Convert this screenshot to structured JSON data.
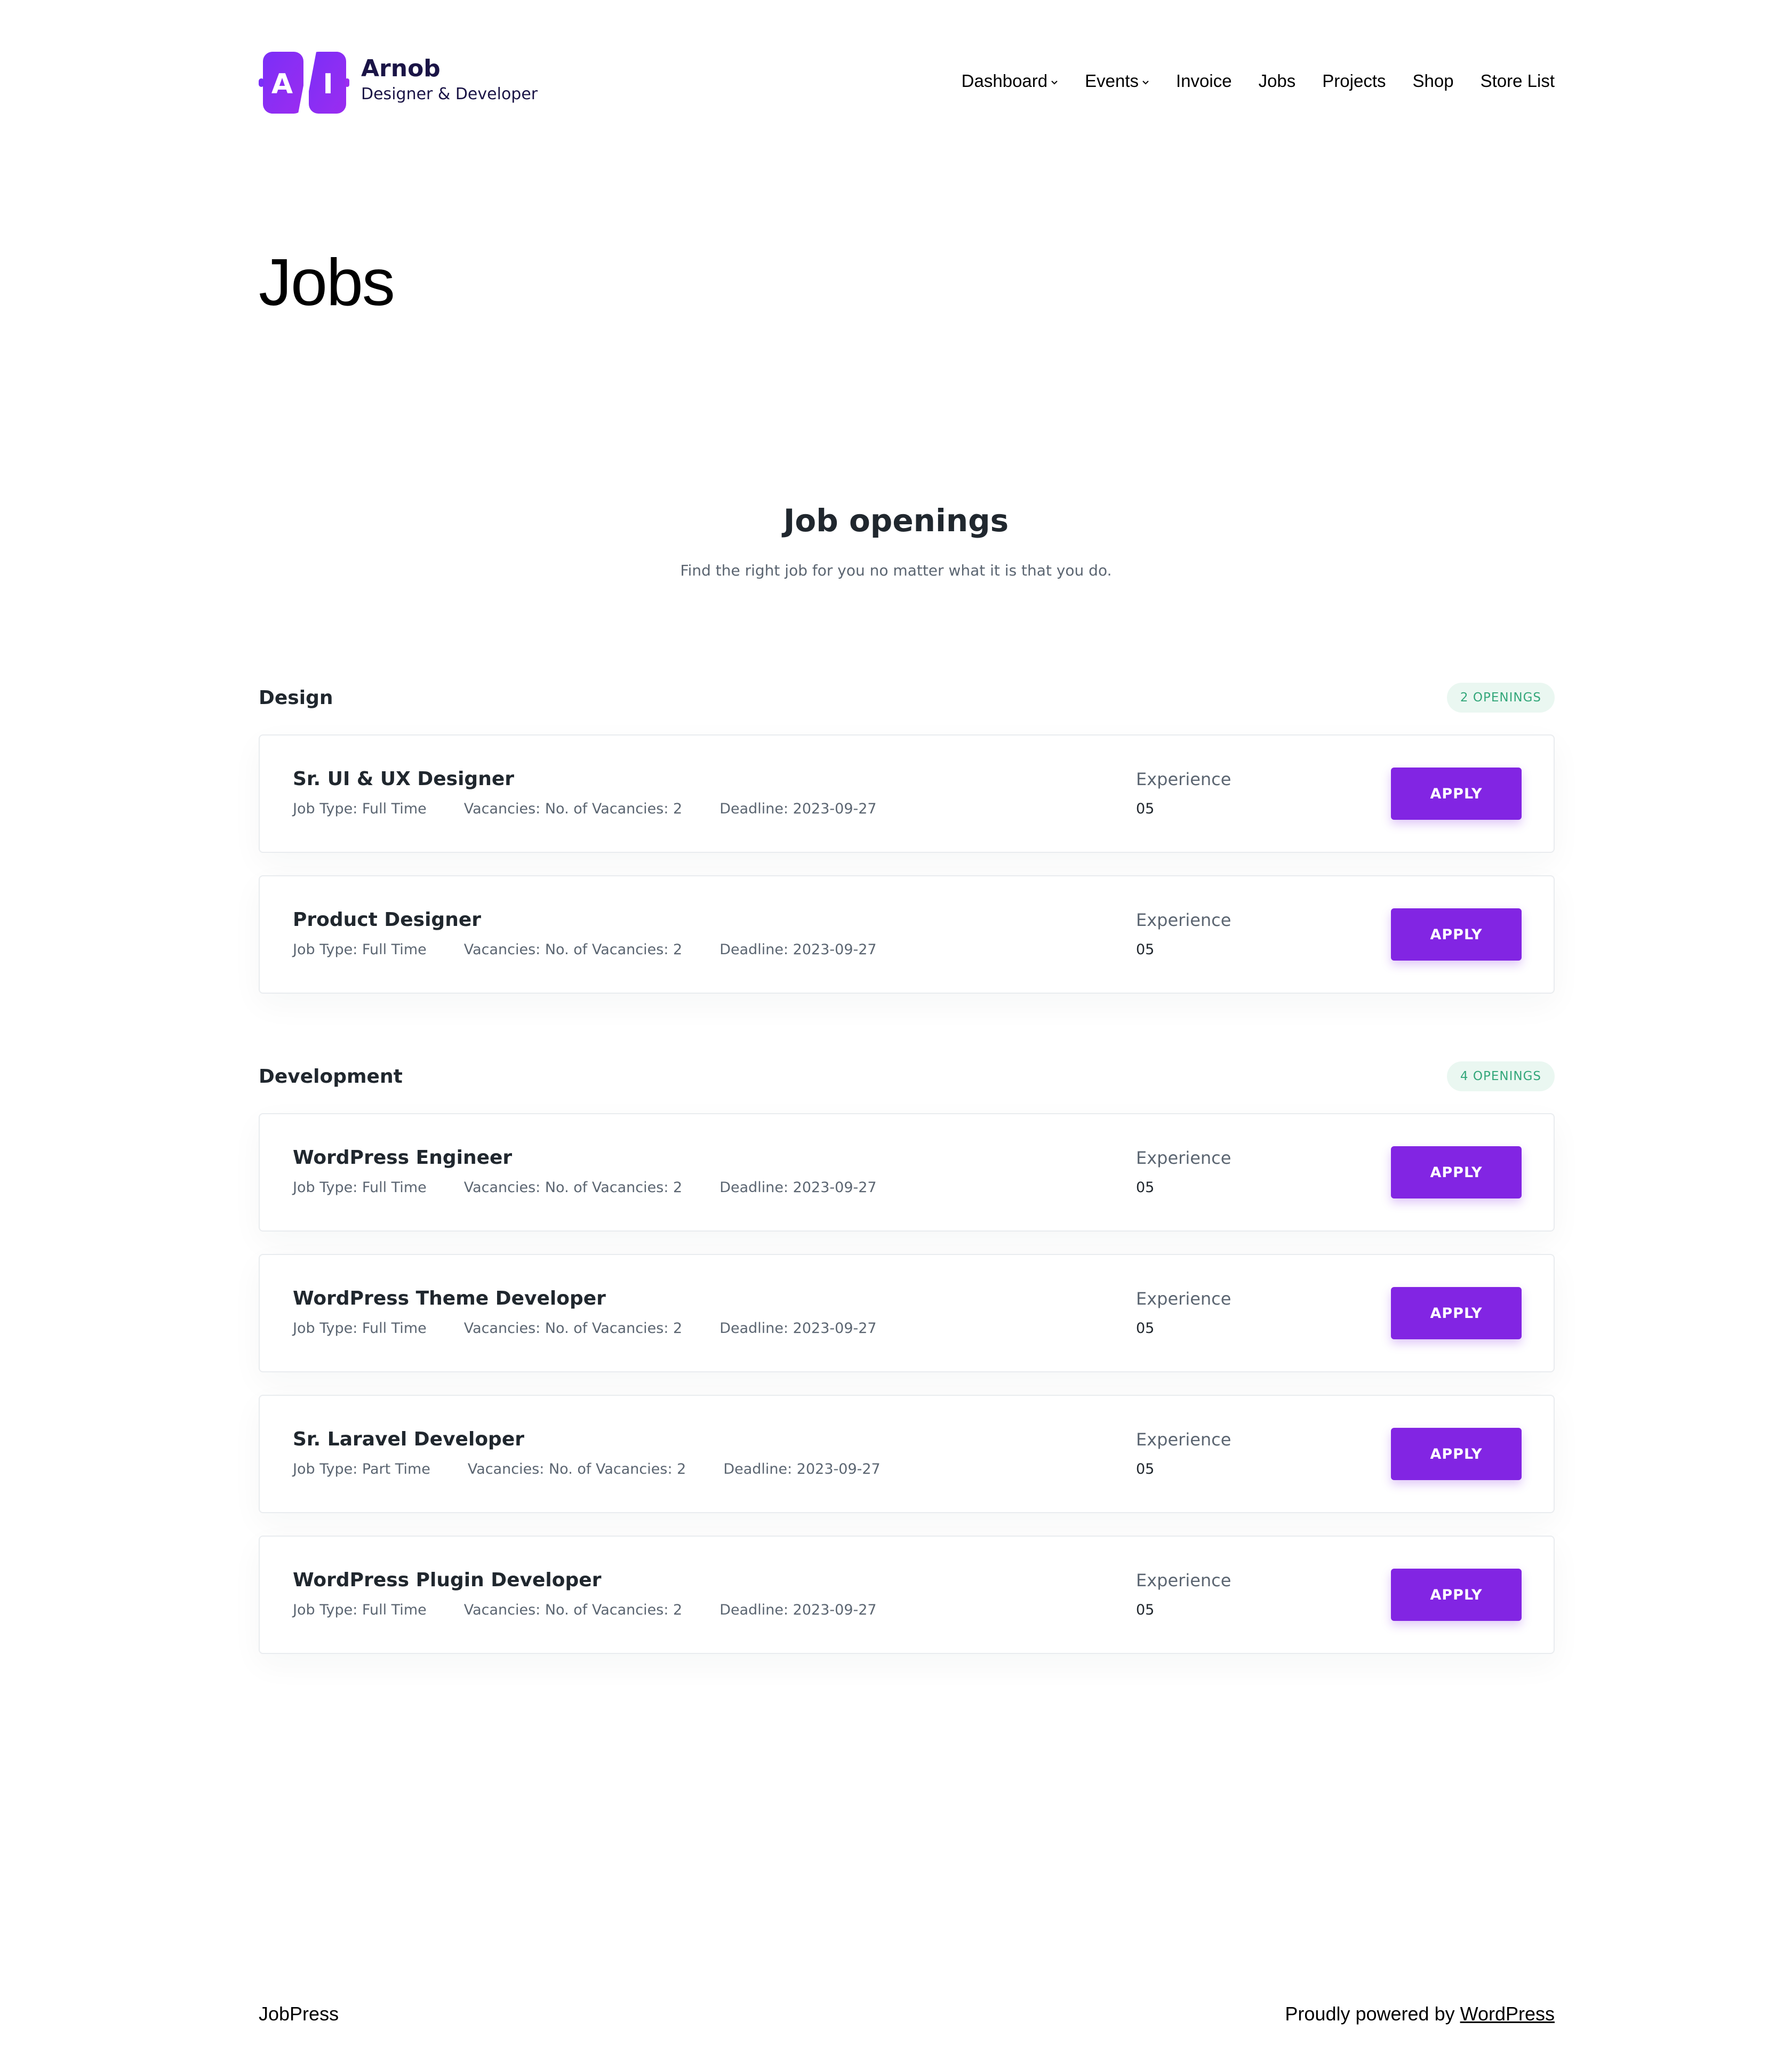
{
  "brand": {
    "logo_text": "A/I",
    "name": "Arnob",
    "tagline": "Designer & Developer",
    "accent": "#8225e3"
  },
  "nav": {
    "items": [
      {
        "label": "Dashboard",
        "has_dropdown": true
      },
      {
        "label": "Events",
        "has_dropdown": true
      },
      {
        "label": "Invoice",
        "has_dropdown": false
      },
      {
        "label": "Jobs",
        "has_dropdown": false
      },
      {
        "label": "Projects",
        "has_dropdown": false
      },
      {
        "label": "Shop",
        "has_dropdown": false
      },
      {
        "label": "Store List",
        "has_dropdown": false
      }
    ]
  },
  "page": {
    "title": "Jobs"
  },
  "openings": {
    "title": "Job openings",
    "subtitle": "Find the right job for you no matter what it is that you do."
  },
  "categories": [
    {
      "name": "Design",
      "badge": "2 OPENINGS",
      "jobs": [
        {
          "title": "Sr. UI & UX Designer",
          "type": "Job Type: Full Time",
          "vacancies": "Vacancies: No. of Vacancies: 2",
          "deadline": "Deadline: 2023-09-27",
          "exp_label": "Experience",
          "exp_value": "05",
          "apply": "APPLY"
        },
        {
          "title": "Product Designer",
          "type": "Job Type: Full Time",
          "vacancies": "Vacancies: No. of Vacancies: 2",
          "deadline": "Deadline: 2023-09-27",
          "exp_label": "Experience",
          "exp_value": "05",
          "apply": "APPLY"
        }
      ]
    },
    {
      "name": "Development",
      "badge": "4 OPENINGS",
      "jobs": [
        {
          "title": "WordPress Engineer",
          "type": "Job Type: Full Time",
          "vacancies": "Vacancies: No. of Vacancies: 2",
          "deadline": "Deadline: 2023-09-27",
          "exp_label": "Experience",
          "exp_value": "05",
          "apply": "APPLY"
        },
        {
          "title": "WordPress Theme Developer",
          "type": "Job Type: Full Time",
          "vacancies": "Vacancies: No. of Vacancies: 2",
          "deadline": "Deadline: 2023-09-27",
          "exp_label": "Experience",
          "exp_value": "05",
          "apply": "APPLY"
        },
        {
          "title": "Sr. Laravel Developer",
          "type": "Job Type: Part Time",
          "vacancies": "Vacancies: No. of Vacancies: 2",
          "deadline": "Deadline: 2023-09-27",
          "exp_label": "Experience",
          "exp_value": "05",
          "apply": "APPLY"
        },
        {
          "title": "WordPress Plugin Developer",
          "type": "Job Type: Full Time",
          "vacancies": "Vacancies: No. of Vacancies: 2",
          "deadline": "Deadline: 2023-09-27",
          "exp_label": "Experience",
          "exp_value": "05",
          "apply": "APPLY"
        }
      ]
    }
  ],
  "footer": {
    "site_name": "JobPress",
    "powered_prefix": "Proudly powered by",
    "powered_link": "WordPress"
  }
}
